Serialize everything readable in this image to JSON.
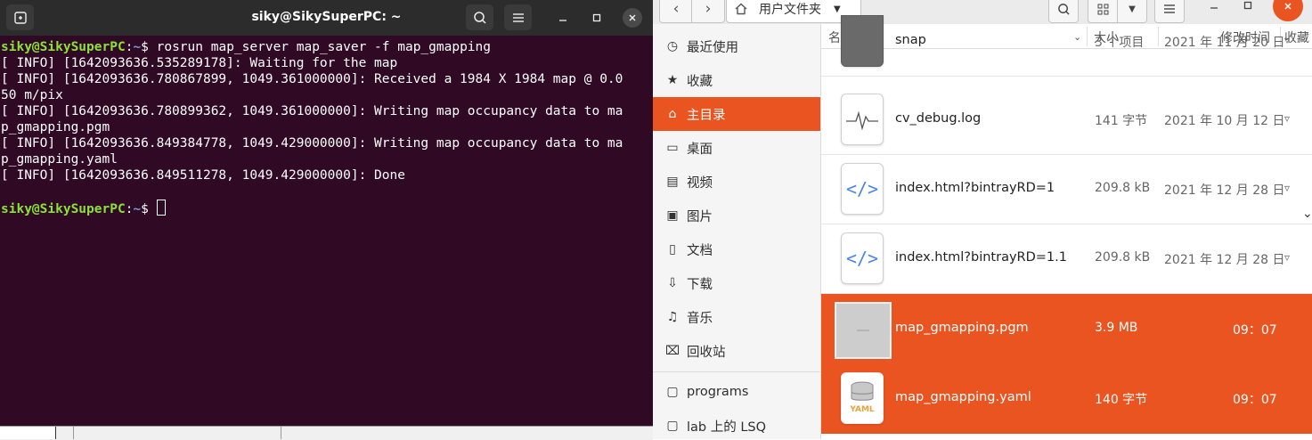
{
  "terminal": {
    "title": "siky@SikySuperPC: ~",
    "prompt_user": "siky@SikySuperPC",
    "prompt_sep": ":",
    "prompt_path": "~",
    "prompt_dollar": "$",
    "command": " rosrun map_server map_saver -f map_gmapping",
    "lines": [
      "[ INFO] [1642093636.535289178]: Waiting for the map",
      "[ INFO] [1642093636.780867899, 1049.361000000]: Received a 1984 X 1984 map @ 0.0",
      "50 m/pix",
      "[ INFO] [1642093636.780899362, 1049.361000000]: Writing map occupancy data to ma",
      "p_gmapping.pgm",
      "[ INFO] [1642093636.849384778, 1049.429000000]: Writing map occupancy data to ma",
      "p_gmapping.yaml",
      "[ INFO] [1642093636.849511278, 1049.429000000]: Done"
    ]
  },
  "file_manager": {
    "path_label": "用户文件夹",
    "columns": {
      "name": "名称",
      "size": "大小",
      "modified": "修改时间",
      "starred": "收藏"
    },
    "sidebar": [
      {
        "label": "最近使用",
        "icon": "clock-icon"
      },
      {
        "label": "收藏",
        "icon": "star-icon"
      },
      {
        "label": "主目录",
        "icon": "home-icon",
        "active": true
      },
      {
        "label": "桌面",
        "icon": "desktop-icon"
      },
      {
        "label": "视频",
        "icon": "video-icon"
      },
      {
        "label": "图片",
        "icon": "image-icon"
      },
      {
        "label": "文档",
        "icon": "document-icon"
      },
      {
        "label": "下载",
        "icon": "download-icon"
      },
      {
        "label": "音乐",
        "icon": "music-icon"
      },
      {
        "label": "回收站",
        "icon": "trash-icon"
      },
      {
        "label": "programs",
        "icon": "folder-icon"
      },
      {
        "label": "lab 上的 LSQ",
        "icon": "folder-icon"
      }
    ],
    "files": [
      {
        "name": "snap",
        "size": "3 个项目",
        "date": "2021 年 11 月 20 日",
        "selected": false
      },
      {
        "name": "cv_debug.log",
        "size": "141 字节",
        "date": "2021 年 10 月 12 日",
        "selected": false
      },
      {
        "name": "index.html?bintrayRD=1",
        "size": "209.8 kB",
        "date": "2021 年 12 月 28 日",
        "selected": false
      },
      {
        "name": "index.html?bintrayRD=1.1",
        "size": "209.8 kB",
        "date": "2021 年 12 月 28 日",
        "selected": false
      },
      {
        "name": "map_gmapping.pgm",
        "size": "3.9 MB",
        "date": "09：07",
        "selected": true
      },
      {
        "name": "map_gmapping.yaml",
        "size": "140 字节",
        "date": "09：07",
        "selected": true
      }
    ],
    "yaml_label": "YAML",
    "accent": "#e95420"
  }
}
